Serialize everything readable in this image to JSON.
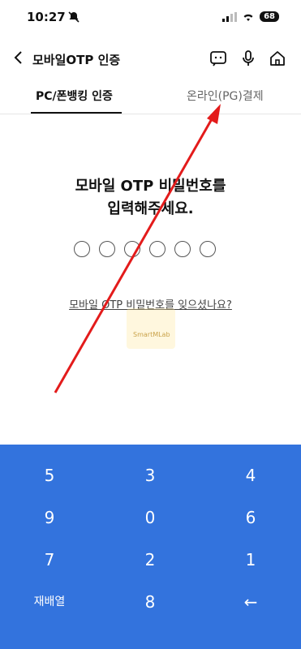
{
  "status": {
    "time": "10:27",
    "battery": "68"
  },
  "header": {
    "title": "모바일OTP 인증"
  },
  "tabs": [
    {
      "label": "PC/폰뱅킹 인증"
    },
    {
      "label": "온라인(PG)결제"
    }
  ],
  "prompt": {
    "line1": "모바일 OTP 비밀번호를",
    "line2": "입력해주세요."
  },
  "pin": {
    "length": 6,
    "filled": 0
  },
  "forgot": {
    "label": "모바일 OTP 비밀번호를 잊으셨나요?"
  },
  "watermark": {
    "text": "SmartMLab"
  },
  "keypad": {
    "keys": [
      "5",
      "3",
      "4",
      "9",
      "0",
      "6",
      "7",
      "2",
      "1"
    ],
    "rearrange": "재배열",
    "bottom_digit": "8",
    "backspace": "←"
  },
  "colors": {
    "keypad_bg": "#3373dd",
    "arrow": "#e31b1b"
  }
}
